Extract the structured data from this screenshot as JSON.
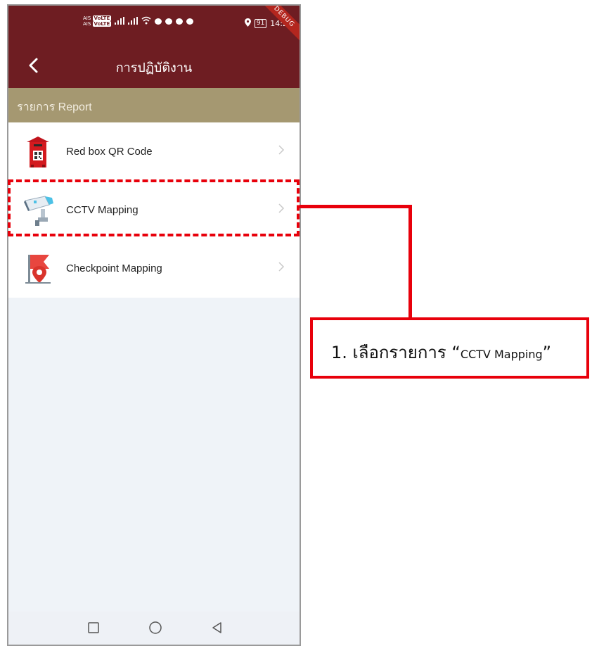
{
  "status_bar": {
    "carrier_1": "AIS",
    "carrier_2": "AIS",
    "network_1": "VoLTE",
    "network_2": "VoLTE",
    "battery": "91",
    "time": "14:23",
    "debug_banner": "DEBUG"
  },
  "app_bar": {
    "title": "การปฏิบัติงาน"
  },
  "section": {
    "title": "รายการ Report"
  },
  "menu": {
    "items": [
      {
        "label": "Red box QR Code",
        "icon": "red-box-qr-icon"
      },
      {
        "label": "CCTV Mapping",
        "icon": "cctv-camera-icon"
      },
      {
        "label": "Checkpoint Mapping",
        "icon": "checkpoint-flag-icon"
      }
    ]
  },
  "annotation": {
    "number": "1.",
    "text": "เลือกรายการ",
    "open_quote": "“",
    "target": "CCTV Mapping",
    "close_quote": "”"
  },
  "colors": {
    "app_bar": "#6e1d22",
    "section_bar": "#a59871",
    "highlight": "#e8000b",
    "background": "#eff3f8"
  }
}
